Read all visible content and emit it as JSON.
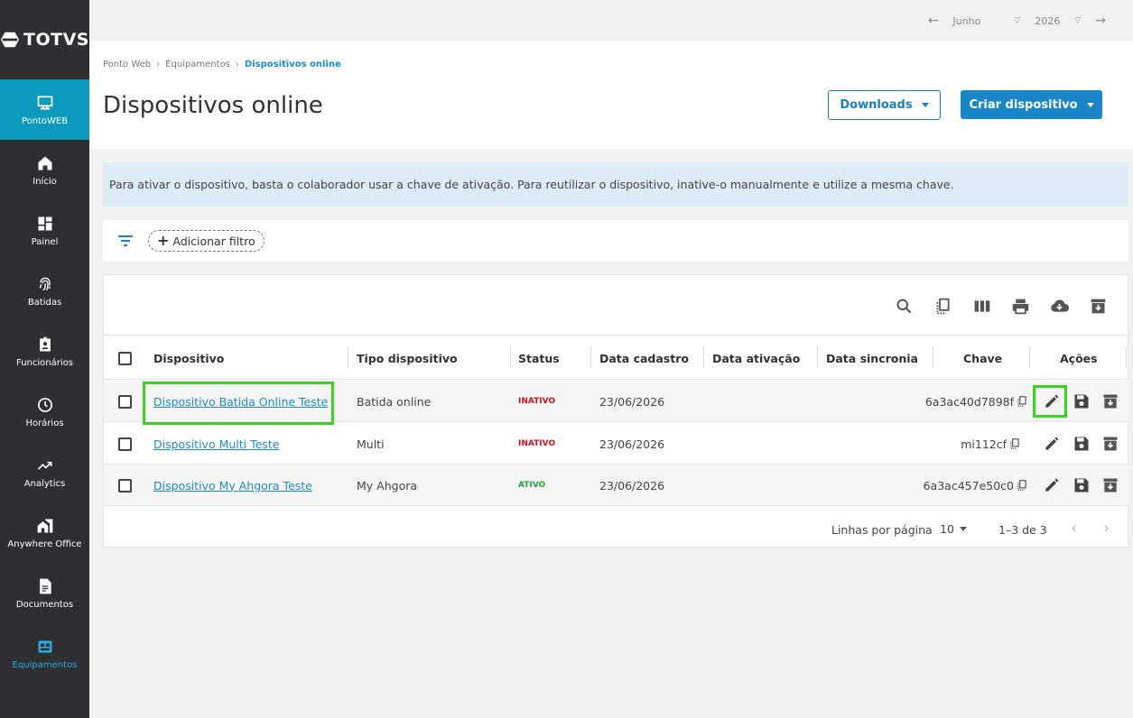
{
  "brand": {
    "name": "TOTVS"
  },
  "sidebar": {
    "items": [
      {
        "label": "PontoWEB",
        "icon": "monitor-icon",
        "active": true
      },
      {
        "label": "Início",
        "icon": "home-icon"
      },
      {
        "label": "Painel",
        "icon": "dashboard-icon"
      },
      {
        "label": "Batidas",
        "icon": "fingerprint-icon"
      },
      {
        "label": "Funcionários",
        "icon": "badge-icon"
      },
      {
        "label": "Horários",
        "icon": "clock-icon"
      },
      {
        "label": "Analytics",
        "icon": "trending-up-icon"
      },
      {
        "label": "Anywhere Office",
        "icon": "home-work-icon"
      },
      {
        "label": "Documentos",
        "icon": "document-icon"
      },
      {
        "label": "Equipamentos",
        "icon": "device-icon"
      }
    ]
  },
  "topbar": {
    "month": "Junho",
    "year": "2026"
  },
  "breadcrumb": {
    "items": [
      "Ponto Web",
      "Equipamentos"
    ],
    "current": "Dispositivos online"
  },
  "page": {
    "title": "Dispositivos online"
  },
  "actions": {
    "downloads": "Downloads",
    "create": "Criar dispositivo"
  },
  "info": {
    "text": "Para ativar o dispositivo, basta o colaborador usar a chave de ativação. Para reutilizar o dispositivo, inative-o manualmente e utilize a mesma chave."
  },
  "filter": {
    "add_label": "Adicionar filtro"
  },
  "table": {
    "columns": [
      "Dispositivo",
      "Tipo dispositivo",
      "Status",
      "Data cadastro",
      "Data ativação",
      "Data sincronia",
      "Chave",
      "Ações"
    ],
    "rows": [
      {
        "device": "Dispositivo Batida Online Teste",
        "type": "Batida online",
        "status": "INATIVO",
        "created": "23/06/2026",
        "activated": "",
        "synced": "",
        "key": "6a3ac40d7898f"
      },
      {
        "device": "Dispositivo Multi Teste",
        "type": "Multi",
        "status": "INATIVO",
        "created": "23/06/2026",
        "activated": "",
        "synced": "",
        "key": "mi112cf"
      },
      {
        "device": "Dispositivo My Ahgora Teste",
        "type": "My Ahgora",
        "status": "ATIVO",
        "created": "23/06/2026",
        "activated": "",
        "synced": "",
        "key": "6a3ac457e50c0"
      }
    ],
    "footer": {
      "rows_per_page_label": "Linhas por página",
      "rows_per_page": "10",
      "range": "1–3 de 3"
    }
  },
  "colors": {
    "sidebar_bg": "#2d2f33",
    "active_nav": "#0c9abe",
    "primary": "#1a86c8",
    "inactive": "#d0111b",
    "active": "#1fa83a",
    "highlight": "#3ad31e"
  }
}
